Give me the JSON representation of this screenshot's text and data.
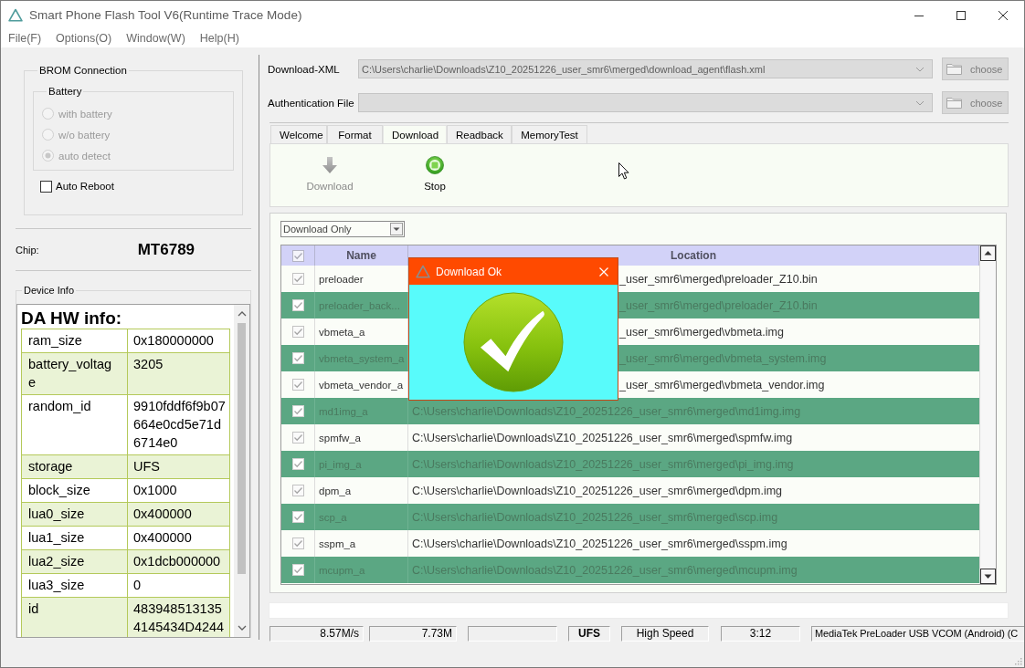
{
  "window": {
    "title": "Smart Phone Flash Tool V6(Runtime Trace Mode)"
  },
  "menu": [
    "File(F)",
    "Options(O)",
    "Window(W)",
    "Help(H)"
  ],
  "brom_connection": {
    "title": "BROM Connection",
    "battery": {
      "title": "Battery",
      "options": [
        {
          "label": "with battery",
          "selected": false,
          "disabled": true
        },
        {
          "label": "w/o battery",
          "selected": false,
          "disabled": true
        },
        {
          "label": "auto detect",
          "selected": true,
          "disabled": true
        }
      ]
    },
    "auto_reboot": {
      "label": "Auto Reboot",
      "checked": false
    }
  },
  "chip": {
    "label": "Chip:",
    "value": "MT6789"
  },
  "device_info": {
    "title": "Device Info",
    "heading": "DA HW info:",
    "rows": [
      {
        "key": "ram_size",
        "value": "0x180000000"
      },
      {
        "key": "battery_voltage",
        "value": "3205"
      },
      {
        "key": "random_id",
        "value": "9910fddf6f9b07664e0cd5e71d6714e0"
      },
      {
        "key": "storage",
        "value": "UFS"
      },
      {
        "key": "block_size",
        "value": "0x1000"
      },
      {
        "key": "lua0_size",
        "value": "0x400000"
      },
      {
        "key": "lua1_size",
        "value": "0x400000"
      },
      {
        "key": "lua2_size",
        "value": "0x1dcb000000"
      },
      {
        "key": "lua3_size",
        "value": "0"
      },
      {
        "key": "id",
        "value": "4839485131354145434D4244"
      }
    ]
  },
  "download_xml": {
    "label": "Download-XML",
    "value": "C:\\Users\\charlie\\Downloads\\Z10_20251226_user_smr6\\merged\\download_agent\\flash.xml",
    "disabled": true,
    "button": "choose"
  },
  "authentication_file": {
    "label": "Authentication File",
    "disabled": true,
    "button": "choose"
  },
  "tabs": [
    {
      "label": "Welcome",
      "selected": false
    },
    {
      "label": "Format",
      "selected": false
    },
    {
      "label": "Download",
      "selected": true
    },
    {
      "label": "Readback",
      "selected": false
    },
    {
      "label": "MemoryTest",
      "selected": false
    }
  ],
  "toolbar": [
    {
      "kind": "download",
      "label": "Download",
      "disabled": true
    },
    {
      "kind": "stop",
      "label": "Stop",
      "disabled": false
    }
  ],
  "download_mode": {
    "value": "Download Only"
  },
  "partition_table": {
    "header_checked": true,
    "columns": [
      "Name",
      "Location"
    ],
    "rows": [
      {
        "checked": true,
        "covered": true,
        "name": "preloader",
        "location": "_user_smr6\\merged\\preloader_Z10.bin"
      },
      {
        "checked": true,
        "covered": true,
        "name": "preloader_back...",
        "location": "_user_smr6\\merged\\preloader_Z10.bin"
      },
      {
        "checked": true,
        "covered": true,
        "name": "vbmeta_a",
        "location": "_user_smr6\\merged\\vbmeta.img"
      },
      {
        "checked": true,
        "covered": true,
        "name": "vbmeta_system_a",
        "location": "_user_smr6\\merged\\vbmeta_system.img"
      },
      {
        "checked": true,
        "covered": true,
        "name": "vbmeta_vendor_a",
        "location": "_user_smr6\\merged\\vbmeta_vendor.img"
      },
      {
        "checked": true,
        "covered": false,
        "name": "md1img_a",
        "location": "C:\\Users\\charlie\\Downloads\\Z10_20251226_user_smr6\\merged\\md1img.img"
      },
      {
        "checked": true,
        "covered": false,
        "name": "spmfw_a",
        "location": "C:\\Users\\charlie\\Downloads\\Z10_20251226_user_smr6\\merged\\spmfw.img"
      },
      {
        "checked": true,
        "covered": false,
        "name": "pi_img_a",
        "location": "C:\\Users\\charlie\\Downloads\\Z10_20251226_user_smr6\\merged\\pi_img.img"
      },
      {
        "checked": true,
        "covered": false,
        "name": "dpm_a",
        "location": "C:\\Users\\charlie\\Downloads\\Z10_20251226_user_smr6\\merged\\dpm.img"
      },
      {
        "checked": true,
        "covered": false,
        "name": "scp_a",
        "location": "C:\\Users\\charlie\\Downloads\\Z10_20251226_user_smr6\\merged\\scp.img"
      },
      {
        "checked": true,
        "covered": false,
        "name": "sspm_a",
        "location": "C:\\Users\\charlie\\Downloads\\Z10_20251226_user_smr6\\merged\\sspm.img"
      },
      {
        "checked": true,
        "covered": false,
        "name": "mcupm_a",
        "location": "C:\\Users\\charlie\\Downloads\\Z10_20251226_user_smr6\\merged\\mcupm.img"
      }
    ]
  },
  "dialog": {
    "title": "Download Ok"
  },
  "progress": {
    "level": 0
  },
  "status_bar": {
    "speed": "8.57M/s",
    "size": "7.73M",
    "storage": "UFS",
    "usb_mode": "High Speed",
    "elapsed": "3:12",
    "port": "MediaTek PreLoader USB VCOM (Android) (C"
  }
}
